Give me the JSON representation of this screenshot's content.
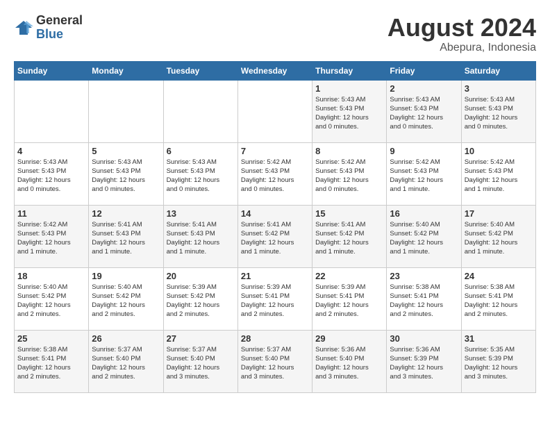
{
  "logo": {
    "general": "General",
    "blue": "Blue"
  },
  "title": {
    "month": "August 2024",
    "location": "Abepura, Indonesia"
  },
  "weekdays": [
    "Sunday",
    "Monday",
    "Tuesday",
    "Wednesday",
    "Thursday",
    "Friday",
    "Saturday"
  ],
  "weeks": [
    [
      {
        "day": "",
        "info": ""
      },
      {
        "day": "",
        "info": ""
      },
      {
        "day": "",
        "info": ""
      },
      {
        "day": "",
        "info": ""
      },
      {
        "day": "1",
        "info": "Sunrise: 5:43 AM\nSunset: 5:43 PM\nDaylight: 12 hours\nand 0 minutes."
      },
      {
        "day": "2",
        "info": "Sunrise: 5:43 AM\nSunset: 5:43 PM\nDaylight: 12 hours\nand 0 minutes."
      },
      {
        "day": "3",
        "info": "Sunrise: 5:43 AM\nSunset: 5:43 PM\nDaylight: 12 hours\nand 0 minutes."
      }
    ],
    [
      {
        "day": "4",
        "info": "Sunrise: 5:43 AM\nSunset: 5:43 PM\nDaylight: 12 hours\nand 0 minutes."
      },
      {
        "day": "5",
        "info": "Sunrise: 5:43 AM\nSunset: 5:43 PM\nDaylight: 12 hours\nand 0 minutes."
      },
      {
        "day": "6",
        "info": "Sunrise: 5:43 AM\nSunset: 5:43 PM\nDaylight: 12 hours\nand 0 minutes."
      },
      {
        "day": "7",
        "info": "Sunrise: 5:42 AM\nSunset: 5:43 PM\nDaylight: 12 hours\nand 0 minutes."
      },
      {
        "day": "8",
        "info": "Sunrise: 5:42 AM\nSunset: 5:43 PM\nDaylight: 12 hours\nand 0 minutes."
      },
      {
        "day": "9",
        "info": "Sunrise: 5:42 AM\nSunset: 5:43 PM\nDaylight: 12 hours\nand 1 minute."
      },
      {
        "day": "10",
        "info": "Sunrise: 5:42 AM\nSunset: 5:43 PM\nDaylight: 12 hours\nand 1 minute."
      }
    ],
    [
      {
        "day": "11",
        "info": "Sunrise: 5:42 AM\nSunset: 5:43 PM\nDaylight: 12 hours\nand 1 minute."
      },
      {
        "day": "12",
        "info": "Sunrise: 5:41 AM\nSunset: 5:43 PM\nDaylight: 12 hours\nand 1 minute."
      },
      {
        "day": "13",
        "info": "Sunrise: 5:41 AM\nSunset: 5:43 PM\nDaylight: 12 hours\nand 1 minute."
      },
      {
        "day": "14",
        "info": "Sunrise: 5:41 AM\nSunset: 5:42 PM\nDaylight: 12 hours\nand 1 minute."
      },
      {
        "day": "15",
        "info": "Sunrise: 5:41 AM\nSunset: 5:42 PM\nDaylight: 12 hours\nand 1 minute."
      },
      {
        "day": "16",
        "info": "Sunrise: 5:40 AM\nSunset: 5:42 PM\nDaylight: 12 hours\nand 1 minute."
      },
      {
        "day": "17",
        "info": "Sunrise: 5:40 AM\nSunset: 5:42 PM\nDaylight: 12 hours\nand 1 minute."
      }
    ],
    [
      {
        "day": "18",
        "info": "Sunrise: 5:40 AM\nSunset: 5:42 PM\nDaylight: 12 hours\nand 2 minutes."
      },
      {
        "day": "19",
        "info": "Sunrise: 5:40 AM\nSunset: 5:42 PM\nDaylight: 12 hours\nand 2 minutes."
      },
      {
        "day": "20",
        "info": "Sunrise: 5:39 AM\nSunset: 5:42 PM\nDaylight: 12 hours\nand 2 minutes."
      },
      {
        "day": "21",
        "info": "Sunrise: 5:39 AM\nSunset: 5:41 PM\nDaylight: 12 hours\nand 2 minutes."
      },
      {
        "day": "22",
        "info": "Sunrise: 5:39 AM\nSunset: 5:41 PM\nDaylight: 12 hours\nand 2 minutes."
      },
      {
        "day": "23",
        "info": "Sunrise: 5:38 AM\nSunset: 5:41 PM\nDaylight: 12 hours\nand 2 minutes."
      },
      {
        "day": "24",
        "info": "Sunrise: 5:38 AM\nSunset: 5:41 PM\nDaylight: 12 hours\nand 2 minutes."
      }
    ],
    [
      {
        "day": "25",
        "info": "Sunrise: 5:38 AM\nSunset: 5:41 PM\nDaylight: 12 hours\nand 2 minutes."
      },
      {
        "day": "26",
        "info": "Sunrise: 5:37 AM\nSunset: 5:40 PM\nDaylight: 12 hours\nand 2 minutes."
      },
      {
        "day": "27",
        "info": "Sunrise: 5:37 AM\nSunset: 5:40 PM\nDaylight: 12 hours\nand 3 minutes."
      },
      {
        "day": "28",
        "info": "Sunrise: 5:37 AM\nSunset: 5:40 PM\nDaylight: 12 hours\nand 3 minutes."
      },
      {
        "day": "29",
        "info": "Sunrise: 5:36 AM\nSunset: 5:40 PM\nDaylight: 12 hours\nand 3 minutes."
      },
      {
        "day": "30",
        "info": "Sunrise: 5:36 AM\nSunset: 5:39 PM\nDaylight: 12 hours\nand 3 minutes."
      },
      {
        "day": "31",
        "info": "Sunrise: 5:35 AM\nSunset: 5:39 PM\nDaylight: 12 hours\nand 3 minutes."
      }
    ]
  ]
}
